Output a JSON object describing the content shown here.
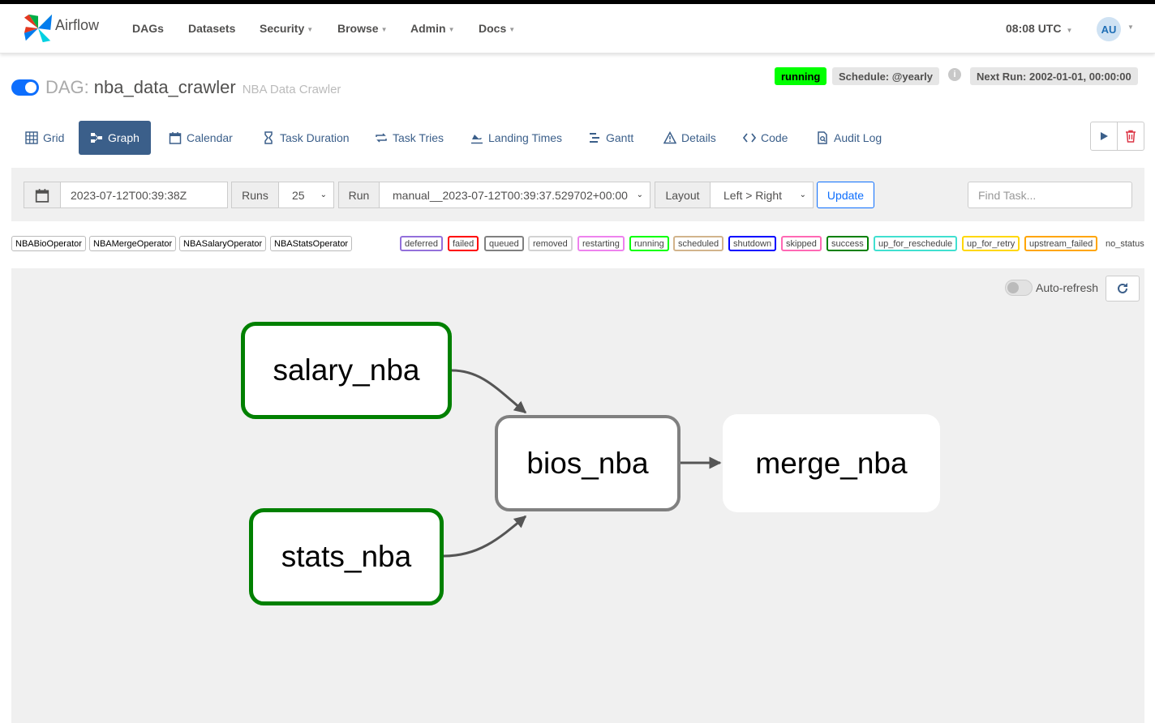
{
  "app": {
    "brand": "Airflow"
  },
  "nav": {
    "items": [
      {
        "label": "DAGs",
        "caret": false
      },
      {
        "label": "Datasets",
        "caret": false
      },
      {
        "label": "Security",
        "caret": true
      },
      {
        "label": "Browse",
        "caret": true
      },
      {
        "label": "Admin",
        "caret": true
      },
      {
        "label": "Docs",
        "caret": true
      }
    ],
    "time": "08:08 UTC",
    "user_initials": "AU"
  },
  "dag": {
    "prefix": "DAG:",
    "id": "nba_data_crawler",
    "description": "NBA Data Crawler",
    "paused": false,
    "state_badge": "running",
    "schedule": "Schedule: @yearly",
    "info": "i",
    "next_run": "Next Run: 2002-01-01, 00:00:00"
  },
  "tabs": [
    {
      "label": "Grid",
      "icon": "grid-icon"
    },
    {
      "label": "Graph",
      "icon": "graph-icon",
      "active": true
    },
    {
      "label": "Calendar",
      "icon": "calendar-icon"
    },
    {
      "label": "Task Duration",
      "icon": "hourglass-icon"
    },
    {
      "label": "Task Tries",
      "icon": "repeat-icon"
    },
    {
      "label": "Landing Times",
      "icon": "landing-icon"
    },
    {
      "label": "Gantt",
      "icon": "gantt-icon"
    },
    {
      "label": "Details",
      "icon": "warning-triangle-icon"
    },
    {
      "label": "Code",
      "icon": "code-icon"
    },
    {
      "label": "Audit Log",
      "icon": "file-search-icon"
    }
  ],
  "controls": {
    "base_date": "2023-07-12T00:39:38Z",
    "runs_label": "Runs",
    "runs_value": "25",
    "run_label": "Run",
    "run_value": "manual__2023-07-12T00:39:37.529702+00:00",
    "layout_label": "Layout",
    "layout_value": "Left > Right",
    "update_label": "Update",
    "find_placeholder": "Find Task..."
  },
  "operators": [
    "NBABioOperator",
    "NBAMergeOperator",
    "NBASalaryOperator",
    "NBAStatsOperator"
  ],
  "states": [
    {
      "label": "deferred",
      "color": "#9370db"
    },
    {
      "label": "failed",
      "color": "#ff0000"
    },
    {
      "label": "queued",
      "color": "#808080"
    },
    {
      "label": "removed",
      "color": "#d3d3d3"
    },
    {
      "label": "restarting",
      "color": "#ee82ee"
    },
    {
      "label": "running",
      "color": "#00ff00"
    },
    {
      "label": "scheduled",
      "color": "#d2b48c"
    },
    {
      "label": "shutdown",
      "color": "#0000ff"
    },
    {
      "label": "skipped",
      "color": "#ff69b4"
    },
    {
      "label": "success",
      "color": "#008000"
    },
    {
      "label": "up_for_reschedule",
      "color": "#40e0d0"
    },
    {
      "label": "up_for_retry",
      "color": "#ffd700"
    },
    {
      "label": "upstream_failed",
      "color": "#ffa500"
    },
    {
      "label": "no_status",
      "color": "#ffffff"
    }
  ],
  "graph": {
    "auto_refresh_label": "Auto-refresh",
    "tasks": [
      {
        "id": "salary_nba",
        "state": "success"
      },
      {
        "id": "stats_nba",
        "state": "success"
      },
      {
        "id": "bios_nba",
        "state": "queued"
      },
      {
        "id": "merge_nba",
        "state": "no_status"
      }
    ]
  }
}
